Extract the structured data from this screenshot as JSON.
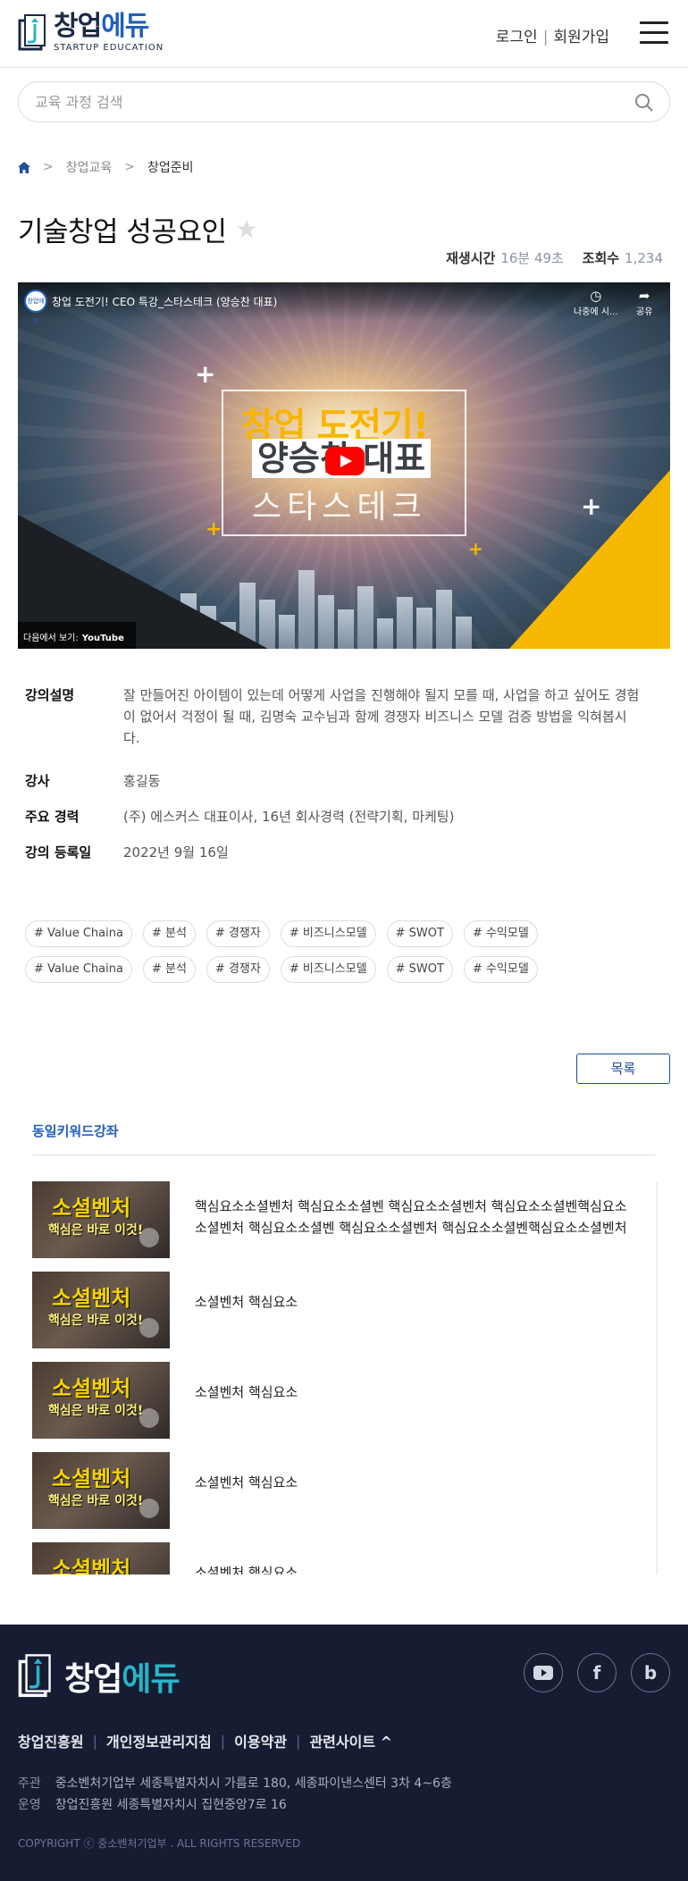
{
  "header": {
    "logo_kr_a": "창업",
    "logo_kr_b": "에듀",
    "logo_en": "STARTUP EDUCATION",
    "login": "로그인",
    "signup": "회원가입"
  },
  "search": {
    "placeholder": "교육 과정 검색"
  },
  "breadcrumb": {
    "items": [
      "창업교육",
      "창업준비"
    ]
  },
  "course": {
    "title": "기술창업 성공요인",
    "play_time_label": "재생시간",
    "play_time": "16분 49초",
    "views_label": "조회수",
    "views": "1,234"
  },
  "video": {
    "channel": "창업에듀",
    "title": "창업 도전기! CEO 특강_스타스테크 (양승찬 대표)",
    "watch_later": "나중에 시...",
    "share": "공유",
    "line1": "창업 도전기!",
    "line2": "양승찬 대표",
    "line3": "스타스테크",
    "watch_on": "다음에서 보기:",
    "youtube": "YouTube"
  },
  "info": {
    "desc_label": "강의설명",
    "desc": "잘 만들어진 아이템이 있는데 어떻게 사업을 진행해야 될지 모를 때, 사업을 하고 싶어도 경험이 없어서 걱정이 될 때, 김명숙 교수님과 함께 경쟁자 비즈니스 모델 검증 방법을 익혀봅시다.",
    "instructor_label": "강사",
    "instructor": "홍길동",
    "career_label": "주요 경력",
    "career": "(주) 에스커스 대표이사, 16년 회사경력 (전략기획, 마케팅)",
    "date_label": "강의 등록일",
    "date": "2022년 9월 16일"
  },
  "tags": [
    "# Value Chaina",
    "# 분석",
    "# 경쟁자",
    "# 비즈니스모델",
    "# SWOT",
    "# 수익모델",
    "# Value Chaina",
    "# 분석",
    "# 경쟁자",
    "# 비즈니스모델",
    "# SWOT",
    "# 수익모델"
  ],
  "list_button": "목록",
  "related": {
    "title": "동일키워드강좌",
    "thumb_line1": "소셜벤처",
    "thumb_line2": "핵심은 바로 이것!",
    "items": [
      "핵심요소소셜벤처 핵심요소소셜벤 핵심요소소셜벤처 핵심요소소셜벤핵심요소소셜벤처 핵심요소소셜벤 핵심요소소셜벤처 핵심요소소셜벤핵심요소소셜벤처",
      "소셜벤처 핵심요소",
      "소셜벤처 핵심요소",
      "소셜벤처 핵심요소",
      "소셜벤처 핵심요소"
    ]
  },
  "footer": {
    "logo_a": "창업",
    "logo_b": "에듀",
    "links": [
      "창업진흥원",
      "개인정보관리지침",
      "이용약관",
      "관련사이트 ^"
    ],
    "host_label": "주관",
    "host": "중소벤처기업부   세종특별자치시 가름로 180, 세종파이낸스센터 3차 4~6층",
    "op_label": "운영",
    "op": "창업진흥원   세종특별자치시 집현중앙7로 16",
    "copyright": "COPYRIGHT ⓒ 중소벤처기업부 . ALL RIGHTS RESERVED"
  },
  "colors": {
    "accent": "#1f5fbf",
    "footer_bg": "#161d33",
    "youtube_red": "#ff0000"
  }
}
